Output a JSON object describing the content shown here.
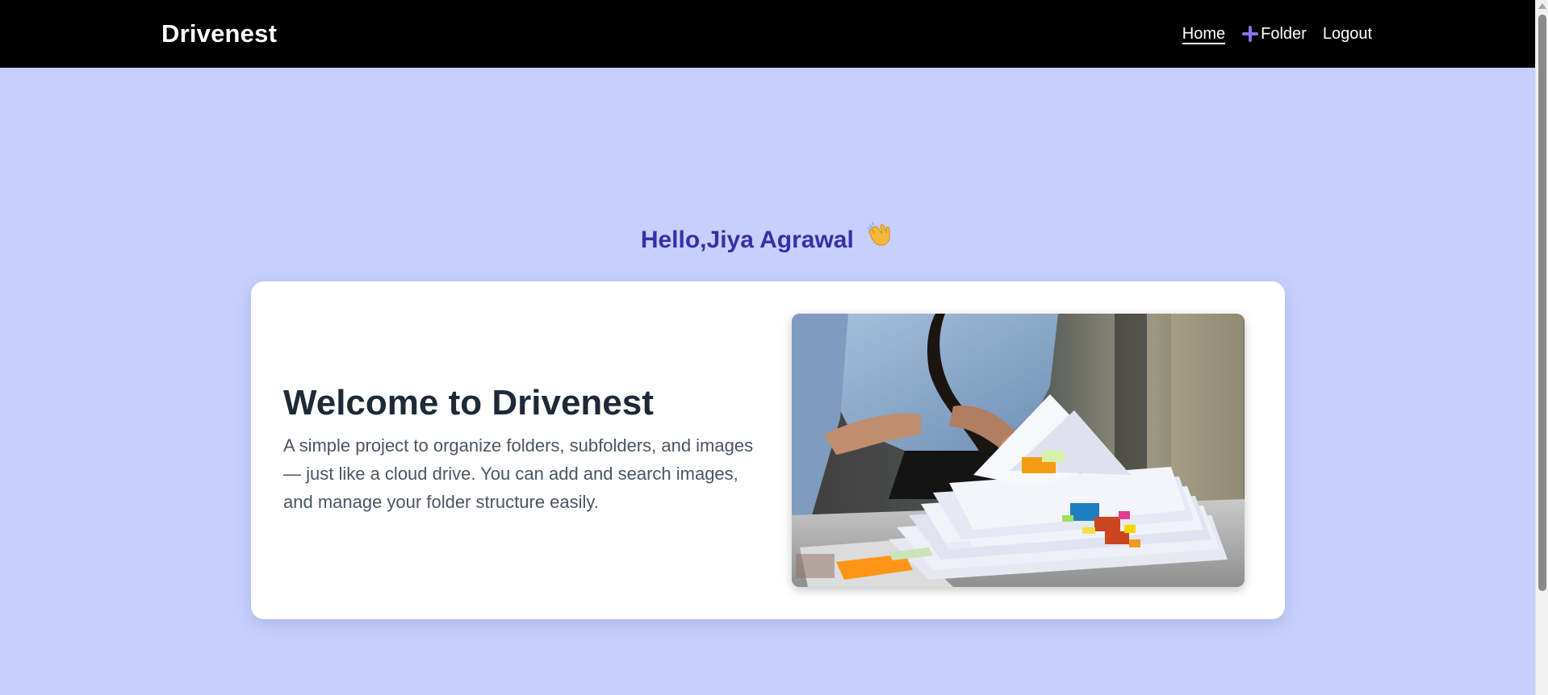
{
  "navbar": {
    "brand": "Drivenest",
    "links": {
      "home": "Home",
      "folder": "Folder",
      "logout": "Logout"
    },
    "icons": {
      "add_folder": "plus-icon"
    }
  },
  "greeting": {
    "text": "Hello,Jiya Agrawal",
    "emoji": "waving-hand-icon"
  },
  "card": {
    "title": "Welcome to Drivenest",
    "description": "A simple project to organize folders, subfolders, and images — just like a cloud drive. You can add and search images, and manage your folder structure easily.",
    "image": "office-papers-photo"
  },
  "colors": {
    "navbar_bg": "#000000",
    "page_bg": "#c7cffd",
    "greeting": "#3730a3",
    "title": "#1f2937",
    "description": "#4b5563",
    "accent_plus": "#8b73e8"
  }
}
